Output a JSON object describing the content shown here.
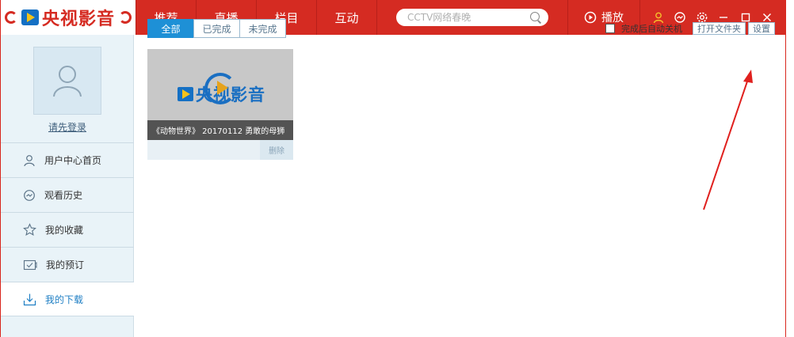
{
  "app": {
    "logo_text": "央视影音"
  },
  "topbar": {
    "nav": [
      "推荐",
      "直播",
      "栏目",
      "互动"
    ],
    "search_placeholder": "CCTV网络春晚",
    "play_label": "播放"
  },
  "sidebar": {
    "login_label": "请先登录",
    "items": [
      {
        "label": "用户中心首页",
        "icon": "user-icon"
      },
      {
        "label": "观看历史",
        "icon": "history-icon"
      },
      {
        "label": "我的收藏",
        "icon": "star-icon"
      },
      {
        "label": "我的预订",
        "icon": "reservation-icon"
      },
      {
        "label": "我的下载",
        "icon": "download-icon",
        "active": true
      }
    ]
  },
  "main": {
    "tabs": [
      "全部",
      "已完成",
      "未完成"
    ],
    "active_tab": "全部",
    "auto_shutdown_label": "完成后自动关机",
    "auto_shutdown_checked": false,
    "open_folder_label": "打开文件夹",
    "settings_label": "设置",
    "downloads": [
      {
        "thumb_logo": "央视影音",
        "title": "《动物世界》 20170112 勇敢的母狮",
        "delete_label": "删除"
      }
    ]
  },
  "colors": {
    "brand_red": "#d52b22",
    "accent_blue": "#1e90d6",
    "annotation_arrow": "#e0201e"
  }
}
